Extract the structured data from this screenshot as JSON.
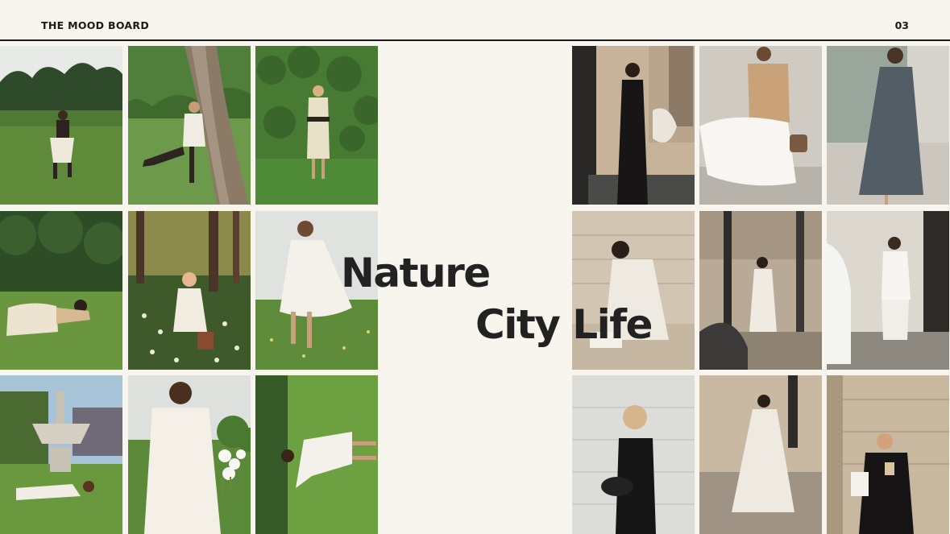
{
  "header": {
    "title": "THE MOOD BOARD",
    "page_number": "03"
  },
  "headings": {
    "nature": "Nature",
    "city": "City Life"
  },
  "nature_photos": [
    "woman-running-in-park-photo",
    "woman-kicking-by-tree-photo",
    "woman-by-hedge-photo",
    "woman-lying-in-grass-photo",
    "girl-sitting-in-flowers-photo",
    "woman-twirling-white-dress-photo",
    "woman-reading-by-fountain-photo",
    "woman-holding-flowers-photo",
    "dress-on-lawn-photo"
  ],
  "city_photos": [
    "woman-black-dress-doorway-photo",
    "woman-sweater-white-skirt-photo",
    "woman-grey-slip-dress-photo",
    "woman-sitting-on-step-photo",
    "woman-leaning-street-pole-photo",
    "woman-white-suit-by-car-photo",
    "girl-black-dress-bag-photo",
    "woman-walking-wall-photo",
    "woman-black-coat-coffee-photo"
  ],
  "colors": {
    "background": "#f8f5ef",
    "rule": "#1c1c1c",
    "text": "#1a1a1a"
  }
}
